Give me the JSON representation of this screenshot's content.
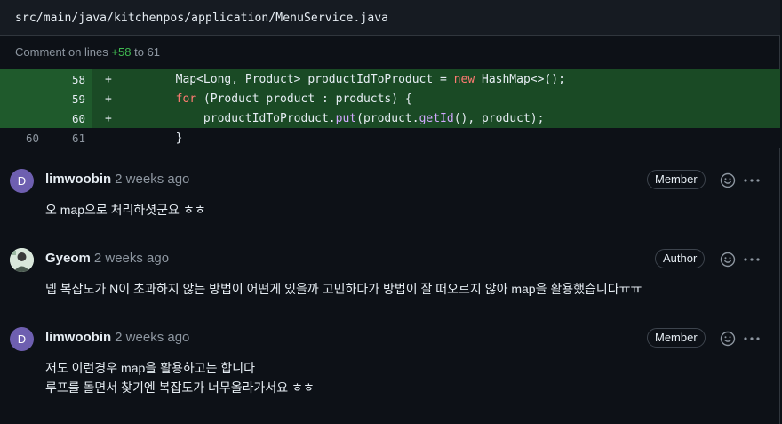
{
  "file": {
    "path": "src/main/java/kitchenpos/application/MenuService.java"
  },
  "comment_lines": {
    "prefix": "Comment on lines",
    "start": "+58",
    "to": "to",
    "end": "61"
  },
  "diff": {
    "rows": [
      {
        "old": "",
        "new": "58",
        "sign": "+",
        "code_pre": "        Map<Long, Product> productIdToProduct = ",
        "code_kw": "new",
        "code_post": " HashMap<>();"
      },
      {
        "old": "",
        "new": "59",
        "sign": "+",
        "code_pre": "        ",
        "code_kw": "for",
        "code_post": " (Product product : products) {"
      },
      {
        "old": "",
        "new": "60",
        "sign": "+",
        "code_pre": "            productIdToProduct.",
        "code_fn1": "put",
        "code_mid": "(product.",
        "code_fn2": "getId",
        "code_post": "(), product);"
      },
      {
        "old": "60",
        "new": "61",
        "sign": "",
        "code_pre": "        }"
      }
    ]
  },
  "comments": [
    {
      "avatar_letter": "D",
      "author": "limwoobin",
      "time": "2 weeks ago",
      "badge": "Member",
      "lines": [
        "오 map으로 처리하셧군요 ㅎㅎ"
      ]
    },
    {
      "avatar_letter": "",
      "author": "Gyeom",
      "time": "2 weeks ago",
      "badge": "Author",
      "lines": [
        "넵 복잡도가 N이 초과하지 않는 방법이 어떤게 있을까 고민하다가 방법이 잘 떠오르지 않아 map을 활용했습니다ㅠㅠ"
      ]
    },
    {
      "avatar_letter": "D",
      "author": "limwoobin",
      "time": "2 weeks ago",
      "badge": "Member",
      "lines": [
        "저도 이런경우 map을 활용하고는 합니다",
        "루프를 돌면서 찾기엔 복잡도가 너무올라가서요 ㅎㅎ"
      ]
    }
  ],
  "icons": {
    "reaction": "smiley-icon",
    "more": "kebab-horizontal-icon"
  },
  "colors": {
    "added_bg": "#1a4a25",
    "keyword": "#ff7b72",
    "function": "#d2a8ff",
    "addition_text": "#3fb950"
  }
}
